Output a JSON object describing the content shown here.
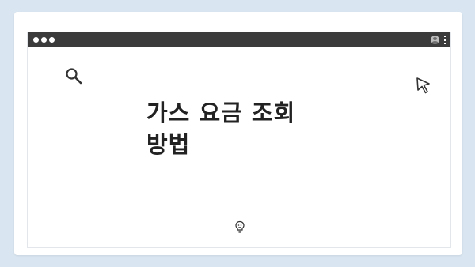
{
  "page": {
    "title_line1": "가스 요금 조회",
    "title_line2": "방법"
  },
  "icons": {
    "search": "search-icon",
    "cursor": "cursor-icon",
    "profile": "profile-icon",
    "menu": "menu-icon",
    "bulb": "lightbulb-icon"
  },
  "colors": {
    "background": "#d9e6f2",
    "titlebar": "#3b3b3b",
    "text": "#222222"
  }
}
